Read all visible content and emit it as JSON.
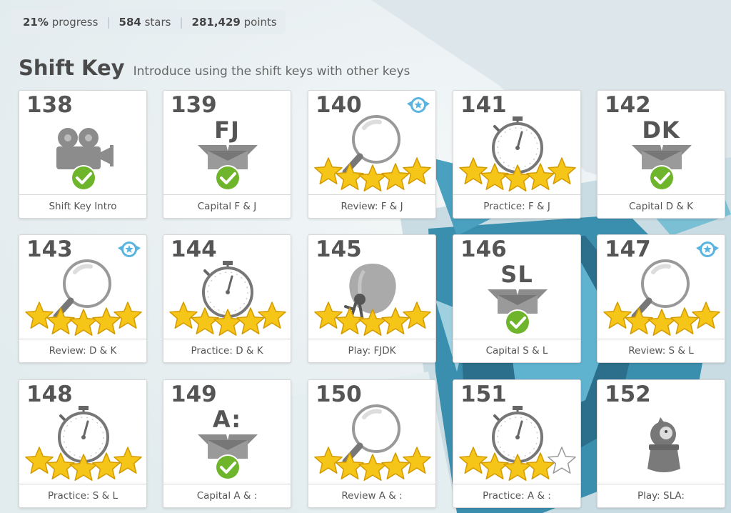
{
  "stats": {
    "progress_value": "21%",
    "progress_label": "progress",
    "stars_value": "584",
    "stars_label": "stars",
    "points_value": "281,429",
    "points_label": "points"
  },
  "lesson": {
    "title": "Shift Key",
    "description": "Introduce using the shift keys with other keys"
  },
  "cards": [
    {
      "number": "138",
      "caption": "Shift Key Intro",
      "type": "video",
      "complete": true,
      "stars": 0,
      "badge": false
    },
    {
      "number": "139",
      "caption": "Capital F & J",
      "type": "keys",
      "keys": "FJ",
      "complete": true,
      "stars": 0,
      "badge": false
    },
    {
      "number": "140",
      "caption": "Review: F & J",
      "type": "review",
      "complete": false,
      "stars": 5,
      "badge": true
    },
    {
      "number": "141",
      "caption": "Practice: F & J",
      "type": "practice",
      "complete": false,
      "stars": 5,
      "badge": false
    },
    {
      "number": "142",
      "caption": "Capital D & K",
      "type": "keys",
      "keys": "DK",
      "complete": true,
      "stars": 0,
      "badge": false
    },
    {
      "number": "143",
      "caption": "Review: D & K",
      "type": "review",
      "complete": false,
      "stars": 5,
      "badge": true
    },
    {
      "number": "144",
      "caption": "Practice: D & K",
      "type": "practice",
      "complete": false,
      "stars": 5,
      "badge": false
    },
    {
      "number": "145",
      "caption": "Play: FJDK",
      "type": "play-balloon",
      "complete": false,
      "stars": 5,
      "badge": false
    },
    {
      "number": "146",
      "caption": "Capital S & L",
      "type": "keys",
      "keys": "SL",
      "complete": true,
      "stars": 0,
      "badge": false
    },
    {
      "number": "147",
      "caption": "Review: S & L",
      "type": "review",
      "complete": false,
      "stars": 5,
      "badge": true
    },
    {
      "number": "148",
      "caption": "Practice: S & L",
      "type": "practice",
      "complete": false,
      "stars": 5,
      "badge": false
    },
    {
      "number": "149",
      "caption": "Capital A & :",
      "type": "keys",
      "keys": "A:",
      "complete": true,
      "stars": 0,
      "badge": false
    },
    {
      "number": "150",
      "caption": "Review A & :",
      "type": "review",
      "complete": false,
      "stars": 5,
      "badge": false
    },
    {
      "number": "151",
      "caption": "Practice: A & :",
      "type": "practice",
      "complete": false,
      "stars": 4,
      "badge": false
    },
    {
      "number": "152",
      "caption": "Play: SLA:",
      "type": "play-jar",
      "complete": false,
      "stars": 0,
      "badge": false
    }
  ],
  "colors": {
    "star_fill": "#f5c518",
    "check_green": "#6fb52c",
    "icon_gray": "#8c8c8c",
    "badge_blue": "#5ab4e0"
  }
}
